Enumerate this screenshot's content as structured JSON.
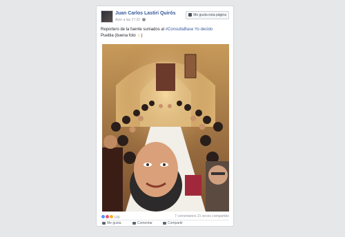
{
  "post": {
    "author": "Juan Carlos Lastiri Quirós",
    "timestamp": "Ayer a las 17:22",
    "like_page_label": "Me gusta esta página",
    "caption_text": "Reportero de la fuente sumados al ",
    "caption_tag": "#ConsultaBase Yo decido",
    "caption_end": "Puebla (buena foto ",
    "photo_alt": "Group selfie at a long dinner table in a restaurant",
    "reaction_count": "146",
    "comments_shares": "7 comentarios  21 veces compartido",
    "actions": {
      "like": "Me gusta",
      "comment": "Comentar",
      "share": "Compartir"
    },
    "colors": {
      "link": "#365899",
      "text": "#1d2129",
      "meta": "#90949c"
    }
  }
}
